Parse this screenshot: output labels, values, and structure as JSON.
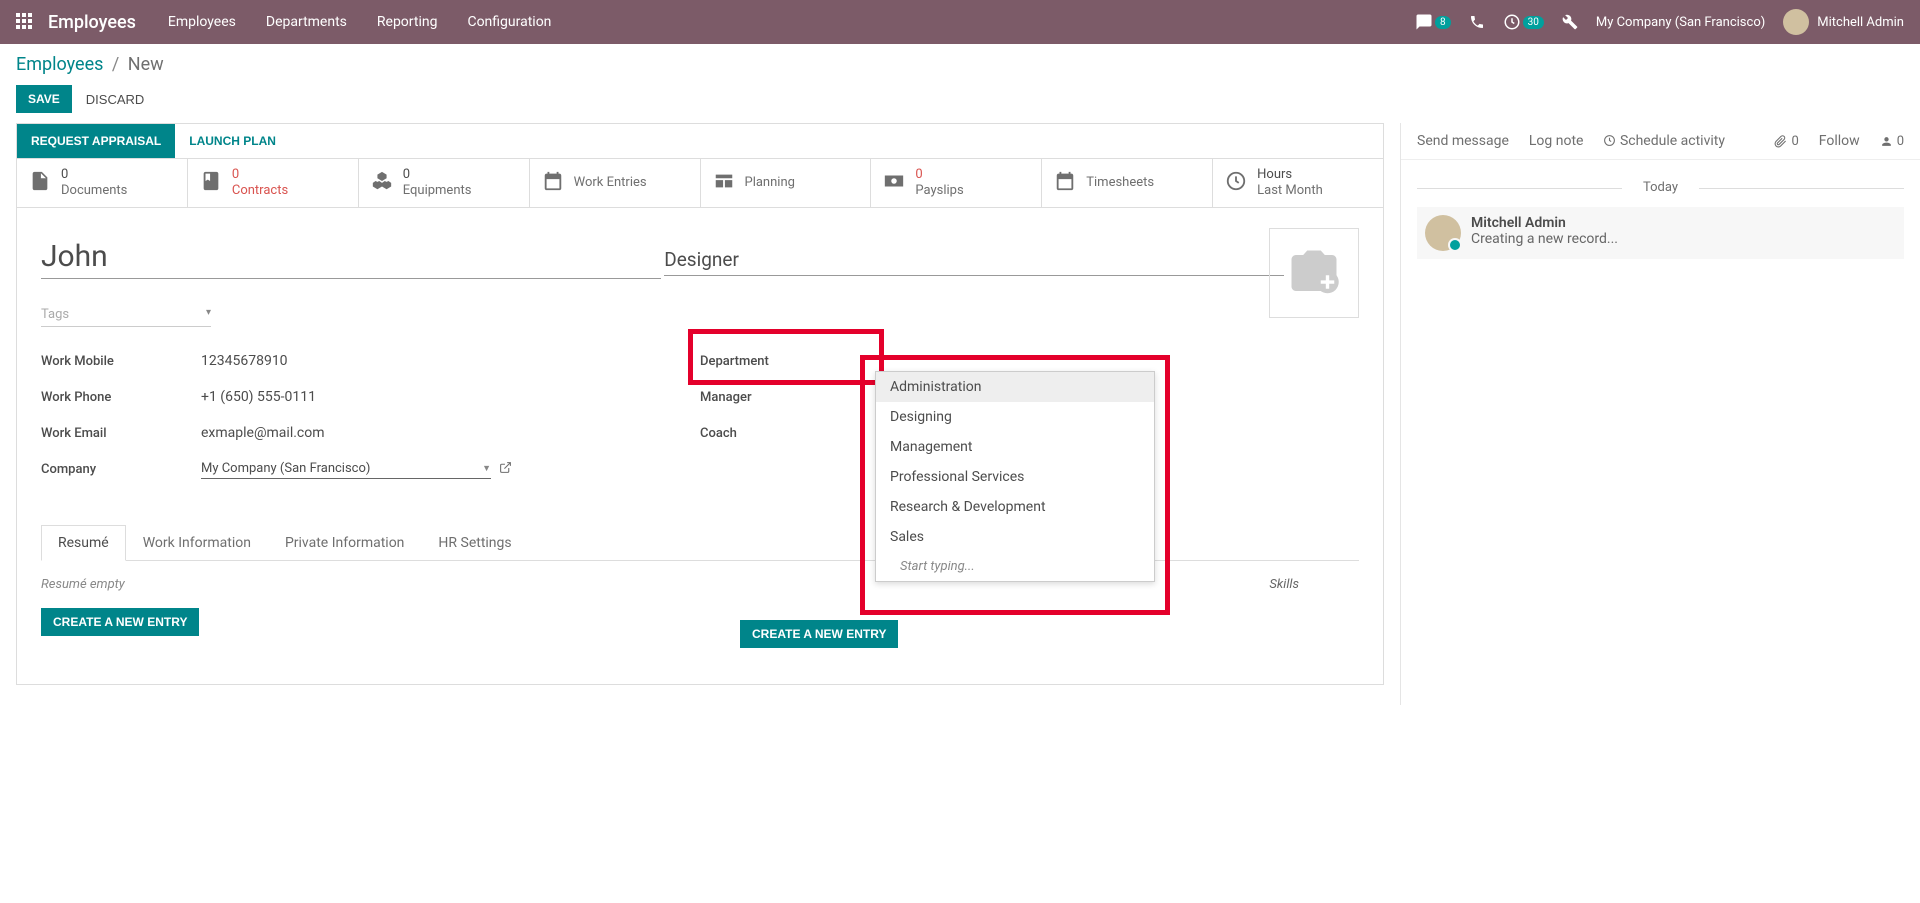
{
  "topnav": {
    "brand": "Employees",
    "menu": [
      "Employees",
      "Departments",
      "Reporting",
      "Configuration"
    ],
    "chat_badge": "8",
    "clock_badge": "30",
    "company": "My Company (San Francisco)",
    "user": "Mitchell Admin"
  },
  "breadcrumb": {
    "root": "Employees",
    "current": "New"
  },
  "actions": {
    "save": "SAVE",
    "discard": "DISCARD"
  },
  "statusbar": {
    "request_appraisal": "REQUEST APPRAISAL",
    "launch_plan": "LAUNCH PLAN"
  },
  "stats": [
    {
      "count": "0",
      "label": "Documents",
      "warn": false,
      "icon": "doc"
    },
    {
      "count": "0",
      "label": "Contracts",
      "warn": true,
      "icon": "book"
    },
    {
      "count": "0",
      "label": "Equipments",
      "warn": false,
      "icon": "cubes"
    },
    {
      "count": "",
      "label": "Work Entries",
      "warn": false,
      "icon": "calendar"
    },
    {
      "count": "",
      "label": "Planning",
      "warn": false,
      "icon": "sched"
    },
    {
      "count": "0",
      "label": "Payslips",
      "warn": true,
      "icon": "money"
    },
    {
      "count": "",
      "label": "Timesheets",
      "warn": false,
      "icon": "calendar"
    },
    {
      "count": "Hours",
      "label": "Last Month",
      "warn": false,
      "icon": "clock"
    }
  ],
  "form": {
    "name": "John",
    "job_title": "Designer",
    "tags_placeholder": "Tags",
    "left": {
      "work_mobile": {
        "label": "Work Mobile",
        "value": "12345678910"
      },
      "work_phone": {
        "label": "Work Phone",
        "value": "+1 (650) 555-0111"
      },
      "work_email": {
        "label": "Work Email",
        "value": "exmaple@mail.com"
      },
      "company": {
        "label": "Company",
        "value": "My Company (San Francisco)"
      }
    },
    "right": {
      "department": {
        "label": "Department"
      },
      "manager": {
        "label": "Manager"
      },
      "coach": {
        "label": "Coach"
      }
    }
  },
  "dropdown": {
    "items": [
      "Administration",
      "Designing",
      "Management",
      "Professional Services",
      "Research & Development",
      "Sales"
    ],
    "footer": "Start typing..."
  },
  "tabs": [
    "Resumé",
    "Work Information",
    "Private Information",
    "HR Settings"
  ],
  "tab_content": {
    "resume_empty": "Resumé empty",
    "create_entry": "CREATE A NEW ENTRY",
    "skills_label": "Skills"
  },
  "chatter": {
    "send": "Send message",
    "log": "Log note",
    "schedule": "Schedule activity",
    "attach_count": "0",
    "follow": "Follow",
    "follow_count": "0",
    "sep": "Today",
    "msg": {
      "name": "Mitchell Admin",
      "body": "Creating a new record..."
    }
  }
}
